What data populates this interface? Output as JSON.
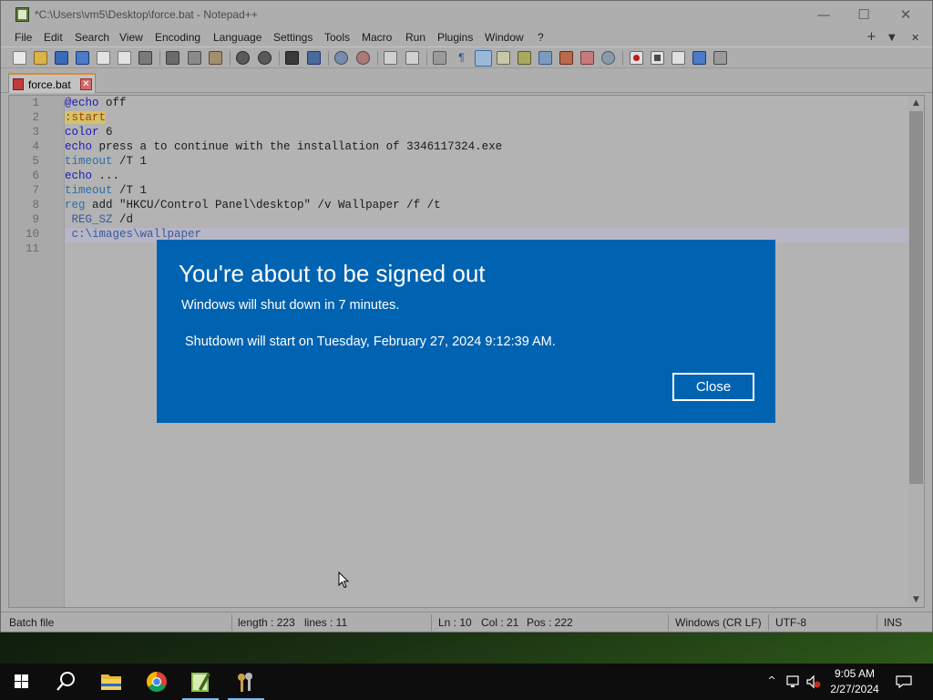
{
  "window": {
    "title": "*C:\\Users\\vm5\\Desktop\\force.bat - Notepad++",
    "controls": {
      "minimize": "—",
      "maximize": "☐",
      "close": "✕"
    }
  },
  "menu": {
    "items": [
      "File",
      "Edit",
      "Search",
      "View",
      "Encoding",
      "Language",
      "Settings",
      "Tools",
      "Macro",
      "Run",
      "Plugins",
      "Window",
      "?"
    ],
    "right": {
      "add": "+",
      "dropdown": "▼",
      "close": "✕"
    }
  },
  "tab": {
    "label": "force.bat",
    "close": "✕"
  },
  "editor": {
    "line_numbers": [
      "1",
      "2",
      "3",
      "4",
      "5",
      "6",
      "7",
      "8",
      "9",
      "10",
      "11"
    ],
    "lines": [
      {
        "kw": "@echo",
        "rest": " off"
      },
      {
        "label": ":start"
      },
      {
        "kw": "color",
        "rest": " 6"
      },
      {
        "kw": "echo",
        "rest": " press a to continue with the installation of 3346117324.exe"
      },
      {
        "kw": "timeout",
        "rest": " /T 1"
      },
      {
        "kw": "echo",
        "rest": " ..."
      },
      {
        "kw": "timeout",
        "rest": " /T 1"
      },
      {
        "kw": "reg",
        "rest": " add \"HKCU/Control Panel\\desktop\" /v Wallpaper /f /t"
      },
      {
        "indent": " ",
        "arg": "REG_SZ",
        "rest": " /d"
      },
      {
        "indent": " ",
        "arg": "c:\\images\\wallpaper",
        "rest": ""
      },
      {
        "rest": ""
      }
    ]
  },
  "status": {
    "file_type": "Batch file",
    "length": "length : 223",
    "lines": "lines : 11",
    "ln": "Ln : 10",
    "col": "Col : 21",
    "pos": "Pos : 222",
    "eol": "Windows (CR LF)",
    "encoding": "UTF-8",
    "mode": "INS"
  },
  "dialog": {
    "title": "You're about to be signed out",
    "message": "Windows will shut down in 7 minutes.",
    "detail": "Shutdown will start on Tuesday, February 27, 2024 9:12:39 AM.",
    "close_label": "Close"
  },
  "taskbar": {
    "clock_time": "9:05 AM",
    "clock_date": "2/27/2024",
    "tray_chevron": "^"
  }
}
